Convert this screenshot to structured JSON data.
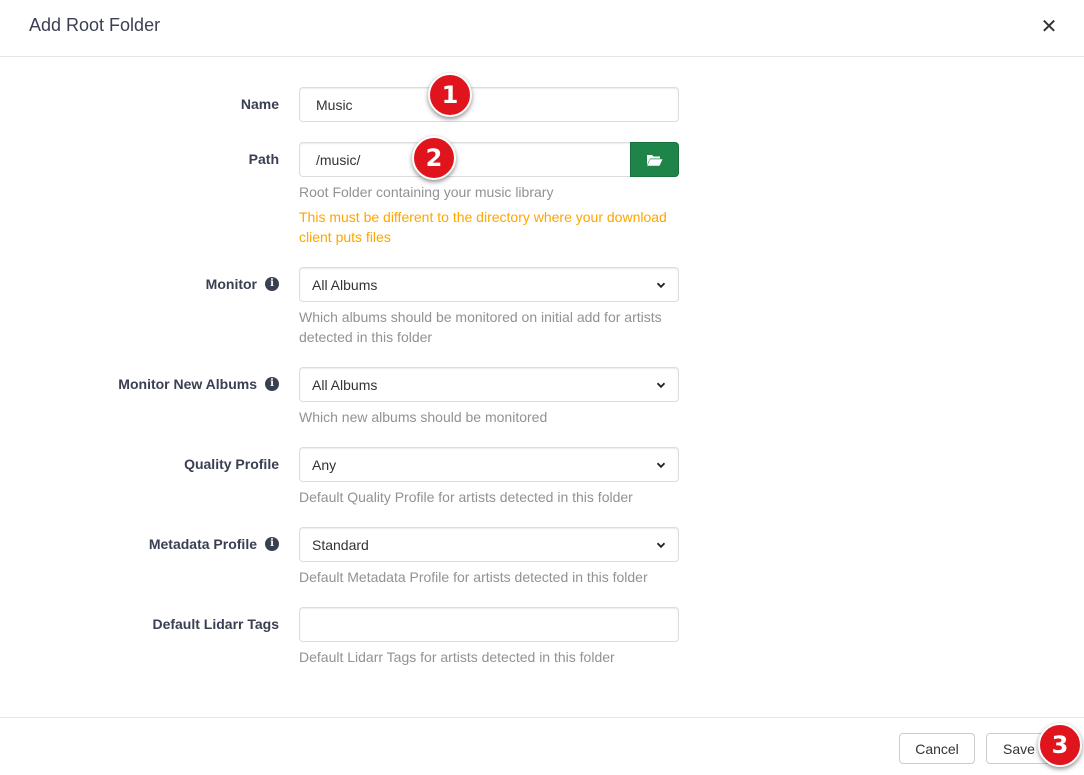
{
  "modal": {
    "title": "Add Root Folder",
    "close_glyph": "✕"
  },
  "fields": {
    "name": {
      "label": "Name",
      "value": "Music"
    },
    "path": {
      "label": "Path",
      "value": "/music/",
      "help": "Root Folder containing your music library",
      "warning": "This must be different to the directory where your download client puts files",
      "button_icon": "folder-open-icon"
    },
    "monitor": {
      "label": "Monitor",
      "value": "All Albums",
      "help": "Which albums should be monitored on initial add for artists detected in this folder"
    },
    "monitor_new_albums": {
      "label": "Monitor New Albums",
      "value": "All Albums",
      "help": "Which new albums should be monitored"
    },
    "quality_profile": {
      "label": "Quality Profile",
      "value": "Any",
      "help": "Default Quality Profile for artists detected in this folder"
    },
    "metadata_profile": {
      "label": "Metadata Profile",
      "value": "Standard",
      "help": "Default Metadata Profile for artists detected in this folder"
    },
    "tags": {
      "label": "Default Lidarr Tags",
      "value": "",
      "help": "Default Lidarr Tags for artists detected in this folder"
    }
  },
  "footer": {
    "cancel_label": "Cancel",
    "save_label": "Save"
  },
  "annotations": [
    "1",
    "2",
    "3"
  ],
  "colors": {
    "accent_green": "#1e8449",
    "warning": "#ffa500",
    "badge_red": "#e0141c"
  }
}
